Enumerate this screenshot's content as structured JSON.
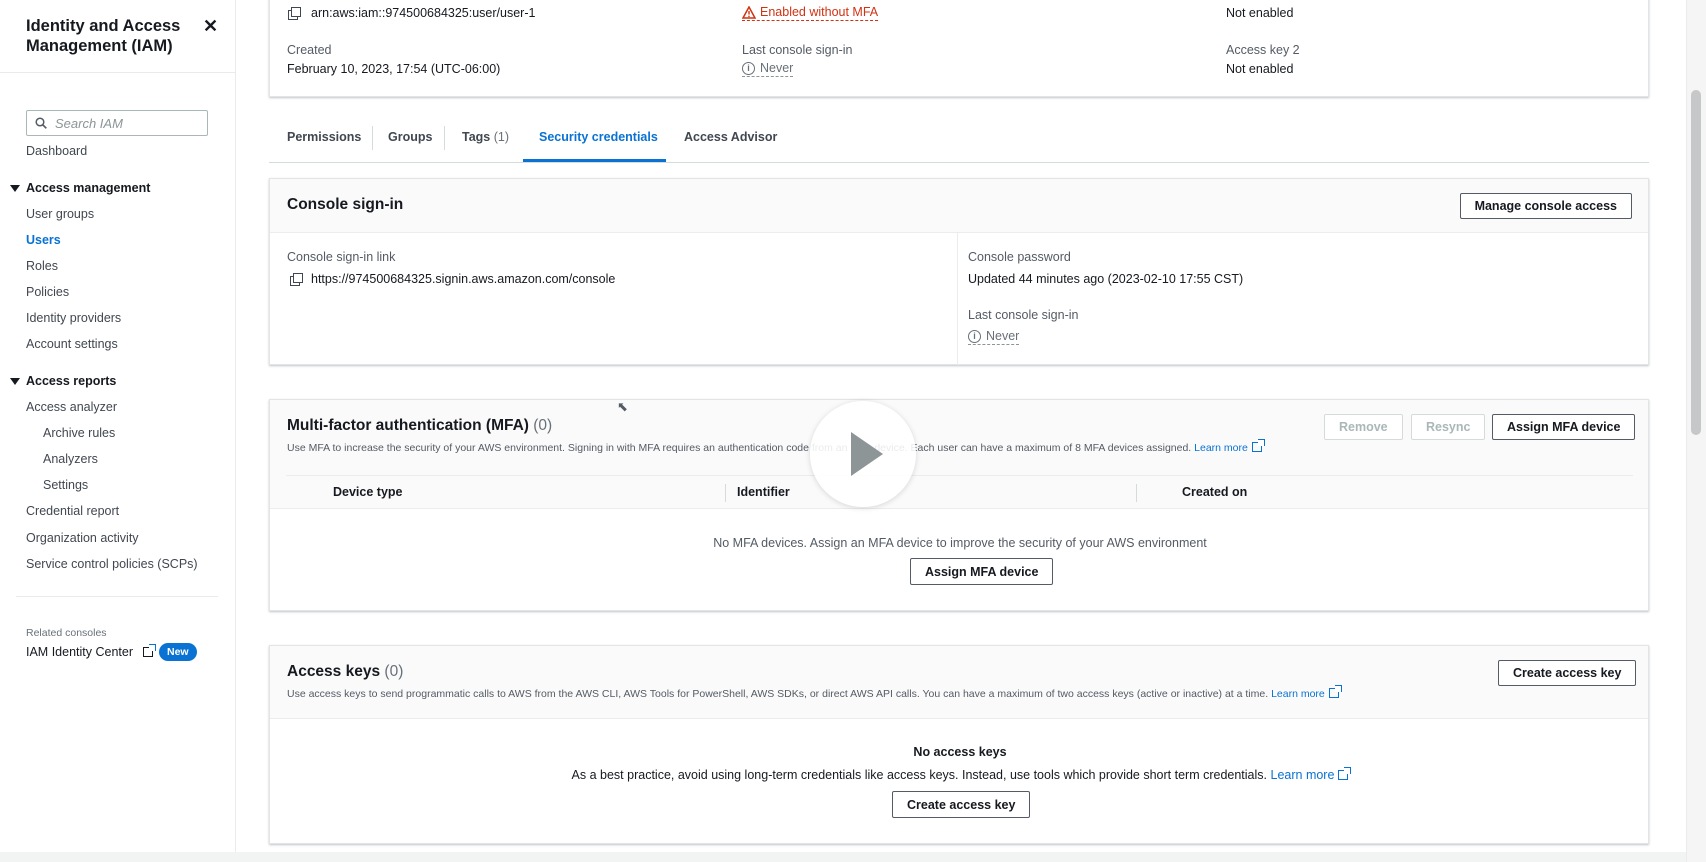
{
  "sidebar": {
    "title": "Identity and Access Management (IAM)",
    "search_placeholder": "Search IAM",
    "dashboard": "Dashboard",
    "access_management": "Access management",
    "am_items": [
      "User groups",
      "Users",
      "Roles",
      "Policies",
      "Identity providers",
      "Account settings"
    ],
    "access_reports": "Access reports",
    "access_analyzer": "Access analyzer",
    "analyzer_items": [
      "Archive rules",
      "Analyzers",
      "Settings"
    ],
    "report_items": [
      "Credential report",
      "Organization activity",
      "Service control policies (SCPs)"
    ],
    "related_consoles": "Related consoles",
    "identity_center": "IAM Identity Center",
    "new_badge": "New"
  },
  "summary": {
    "arn": "arn:aws:iam::974500684325:user/user-1",
    "console_access": "Enabled without MFA",
    "access_key_1_status": "Not enabled",
    "created_label": "Created",
    "created_value": "February 10, 2023, 17:54 (UTC-06:00)",
    "last_signin_label": "Last console sign-in",
    "last_signin_value": "Never",
    "access_key_2_label": "Access key 2",
    "access_key_2_value": "Not enabled"
  },
  "tabs": [
    {
      "label": "Permissions",
      "count": ""
    },
    {
      "label": "Groups",
      "count": ""
    },
    {
      "label": "Tags",
      "count": "(1)"
    },
    {
      "label": "Security credentials",
      "count": ""
    },
    {
      "label": "Access Advisor",
      "count": ""
    }
  ],
  "console_signin": {
    "title": "Console sign-in",
    "manage_button": "Manage console access",
    "link_label": "Console sign-in link",
    "link_value": "https://974500684325.signin.aws.amazon.com/console",
    "password_label": "Console password",
    "password_value": "Updated 44 minutes ago (2023-02-10 17:55 CST)",
    "last_signin_label": "Last console sign-in",
    "last_signin_value": "Never"
  },
  "mfa": {
    "title": "Multi-factor authentication (MFA)",
    "count": "(0)",
    "description": "Use MFA to increase the security of your AWS environment. Signing in with MFA requires an authentication code from an MFA device. Each user can have a maximum of 8 MFA devices assigned.",
    "learn_more": "Learn more",
    "remove_button": "Remove",
    "resync_button": "Resync",
    "assign_button": "Assign MFA device",
    "columns": [
      "Device type",
      "Identifier",
      "Created on"
    ],
    "empty_text": "No MFA devices. Assign an MFA device to improve the security of your AWS environment",
    "empty_button": "Assign MFA device"
  },
  "access_keys": {
    "title": "Access keys",
    "count": "(0)",
    "description": "Use access keys to send programmatic calls to AWS from the AWS CLI, AWS Tools for PowerShell, AWS SDKs, or direct AWS API calls. You can have a maximum of two access keys (active or inactive) at a time.",
    "learn_more": "Learn more",
    "create_button": "Create access key",
    "empty_title": "No access keys",
    "empty_text": "As a best practice, avoid using long-term credentials like access keys. Instead, use tools which provide short term credentials.",
    "empty_learn_more": "Learn more",
    "empty_button": "Create access key"
  },
  "colors": {
    "accent": "#0972d3",
    "warning": "#d13212",
    "text": "#16191f"
  }
}
